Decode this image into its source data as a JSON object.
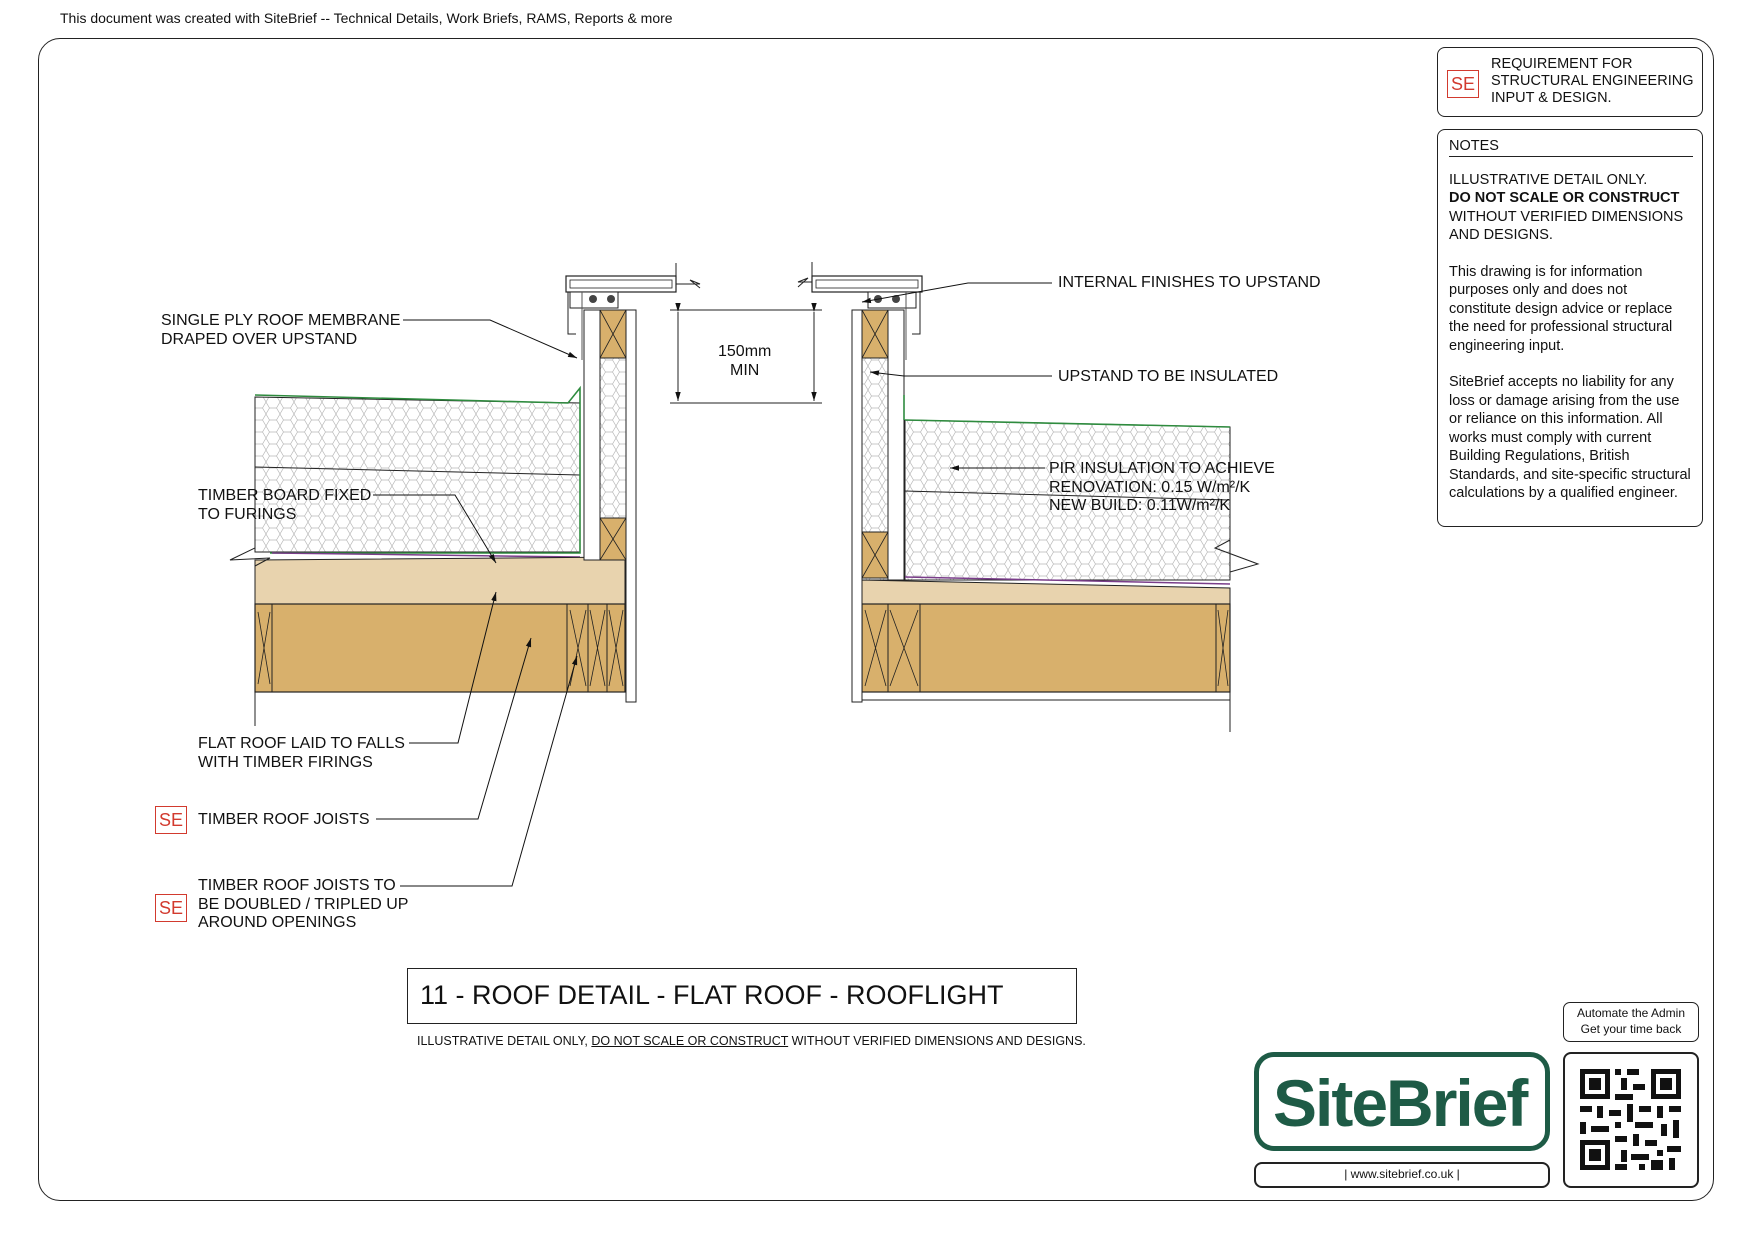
{
  "header": {
    "text": "This document was created with SiteBrief -- Technical Details, Work Briefs, RAMS, Reports & more"
  },
  "legend": {
    "se_code": "SE",
    "text": "REQUIREMENT FOR STRUCTURAL ENGINEERING INPUT & DESIGN."
  },
  "notes": {
    "heading": "NOTES",
    "p1_line1": "ILLUSTRATIVE DETAIL ONLY.",
    "p1_bold": "DO NOT SCALE OR CONSTRUCT",
    "p1_rest": "WITHOUT VERIFIED DIMENSIONS AND DESIGNS.",
    "p2": "This drawing is for information purposes only and does not constitute design advice or replace the need for professional structural engineering input.",
    "p3": "SiteBrief accepts no liability for any loss or damage arising from the use or reliance on this information. All works must comply with current Building Regulations, British Standards, and site-specific structural calculations by a qualified engineer."
  },
  "labels": {
    "membrane": "SINGLE PLY ROOF MEMBRANE\nDRAPED OVER UPSTAND",
    "timber_board": "TIMBER BOARD FIXED\nTO FURINGS",
    "flat_roof": "FLAT ROOF LAID TO FALLS\nWITH TIMBER FIRINGS",
    "joists": "TIMBER ROOF JOISTS",
    "joists_doubled": "TIMBER ROOF JOISTS TO\nBE DOUBLED / TRIPLED UP\nAROUND OPENINGS",
    "internal_finishes": "INTERNAL FINISHES TO UPSTAND",
    "upstand_insulated": "UPSTAND TO BE INSULATED",
    "pir": "PIR INSULATION TO ACHIEVE\nRENOVATION: 0.15 W/m²/K\nNEW BUILD:     0.11W/m²/K",
    "dimension": "150mm\nMIN",
    "se_code": "SE"
  },
  "title": "11 - ROOF DETAIL - FLAT ROOF - ROOFLIGHT",
  "disclaimer": {
    "before": "ILLUSTRATIVE DETAIL ONLY, ",
    "underlined": "DO NOT SCALE OR CONSTRUCT",
    "after": " WITHOUT VERIFIED DIMENSIONS AND DESIGNS."
  },
  "brand": {
    "name": "SiteBrief",
    "url": "|  www.sitebrief.co.uk  |",
    "promo_line1": "Automate the Admin",
    "promo_line2": "Get your time back",
    "color": "#1e5b46"
  },
  "colors": {
    "timber": "#d8b06c",
    "board": "#e8d3ae",
    "membrane": "#2e8b3e",
    "se_red": "#d23a2e",
    "vapour": "#7a3d8a"
  }
}
